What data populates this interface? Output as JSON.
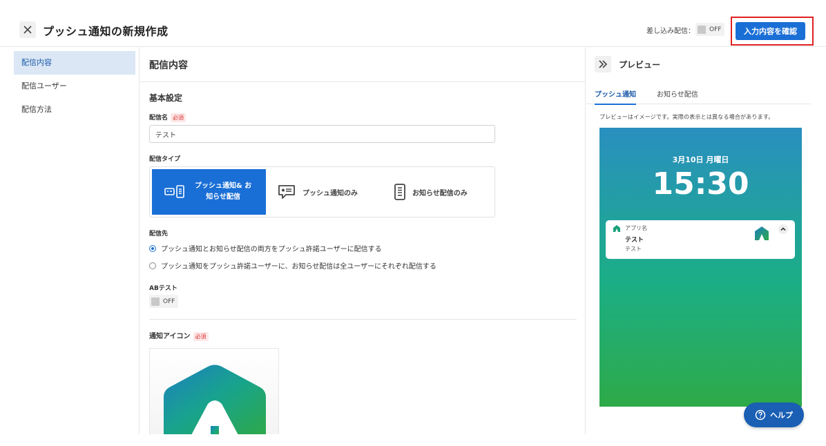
{
  "header": {
    "title": "プッシュ通知の新規作成",
    "merge_label": "差し込み配信：",
    "merge_toggle": "OFF",
    "confirm_label": "入力内容を確認"
  },
  "sidebar": {
    "items": [
      {
        "label": "配信内容",
        "active": true
      },
      {
        "label": "配信ユーザー",
        "active": false
      },
      {
        "label": "配信方法",
        "active": false
      }
    ]
  },
  "main": {
    "section_title": "配信内容",
    "basic_title": "基本設定",
    "name_label": "配信名",
    "required": "必須",
    "name_value": "テスト",
    "type_label": "配信タイプ",
    "types": [
      {
        "label_line1": "プッシュ通知& お",
        "label_line2": "知らせ配信",
        "active": true
      },
      {
        "label": "プッシュ通知のみ",
        "active": false
      },
      {
        "label": "お知らせ配信のみ",
        "active": false
      }
    ],
    "dest_label": "配信先",
    "dest_options": [
      {
        "label": "プッシュ通知とお知らせ配信の両方をプッシュ許諾ユーザーに配信する",
        "checked": true
      },
      {
        "label": "プッシュ通知をプッシュ許諾ユーザーに、お知らせ配信は全ユーザーにそれぞれ配信する",
        "checked": false
      }
    ],
    "ab_label": "ABテスト",
    "ab_toggle": "OFF",
    "icon_label": "通知アイコン"
  },
  "preview": {
    "title": "プレビュー",
    "tabs": [
      {
        "label": "プッシュ通知",
        "active": true
      },
      {
        "label": "お知らせ配信",
        "active": false
      }
    ],
    "note": "プレビューはイメージです。実際の表示とは異なる場合があります。",
    "date": "3月10日 月曜日",
    "time": "15:30",
    "notif_app": "アプリ名",
    "notif_title": "テスト",
    "notif_body": "テスト"
  },
  "help_label": "ヘルプ",
  "colors": {
    "accent": "#1a6fd6",
    "highlight_border": "#e02020",
    "required": "#d33333"
  }
}
